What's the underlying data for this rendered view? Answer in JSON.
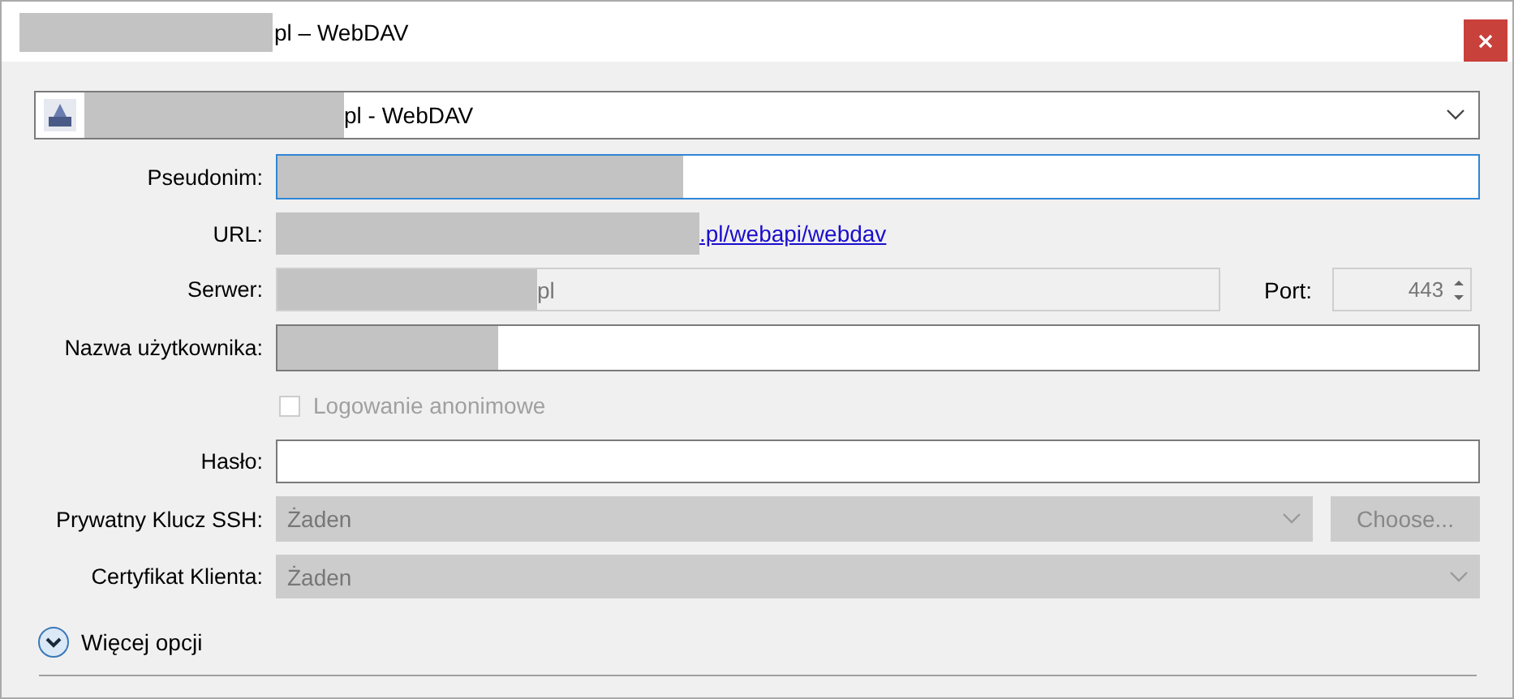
{
  "window": {
    "title": "pl – WebDAV"
  },
  "site_dropdown": {
    "value": "pl - WebDAV"
  },
  "pseudonym": {
    "label": "Pseudonim:",
    "focused": true
  },
  "url": {
    "label": "URL:",
    "link": ".pl/webapi/webdav"
  },
  "server": {
    "label": "Serwer:",
    "value": "pl",
    "disabled": true,
    "port_label": "Port:",
    "port": "443"
  },
  "username": {
    "label": "Nazwa użytkownika:",
    "focused": false
  },
  "anonymous": {
    "label": "Logowanie anonimowe",
    "checked": false,
    "disabled": true
  },
  "password": {
    "label": "Hasło:",
    "focused": false
  },
  "ssh_key": {
    "label": "Prywatny Klucz SSH:",
    "value": "Żaden",
    "disabled": true,
    "button": "Choose..."
  },
  "client_cert": {
    "label": "Certyfikat Klienta:",
    "value": "Żaden",
    "disabled": true
  },
  "more_options": {
    "label": "Więcej opcji",
    "expanded": false
  }
}
